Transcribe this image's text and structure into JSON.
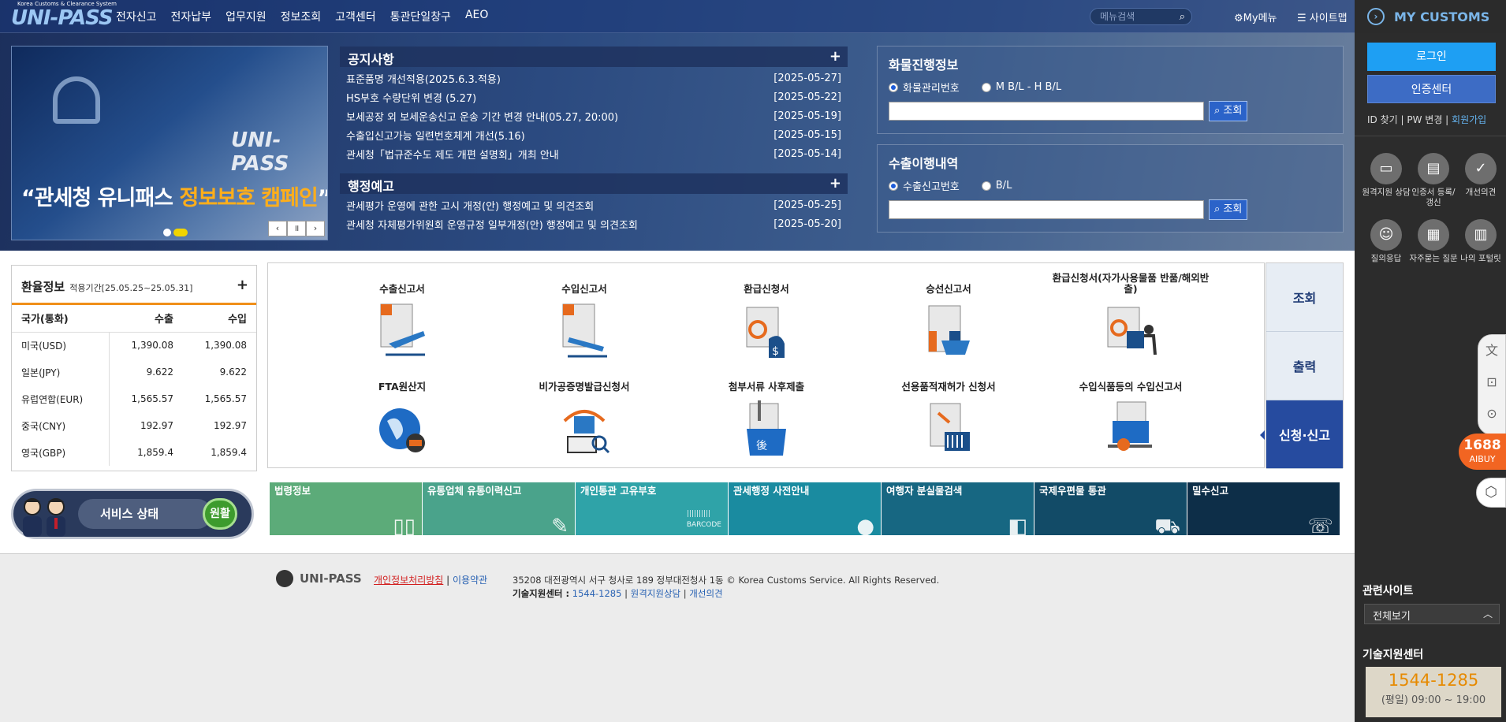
{
  "header": {
    "logo_sub": "Korea Customs & Clearance System",
    "logo": "UNI-PASS",
    "menu": [
      "전자신고",
      "전자납부",
      "업무지원",
      "정보조회",
      "고객센터",
      "통관단일창구",
      "AEO"
    ],
    "search_placeholder": "메뉴검색",
    "mymenu": "My메뉴",
    "sitemap": "사이트맵"
  },
  "banner": {
    "logo": "UNI-PASS",
    "caption_pre": "“관세청 유니패스 ",
    "caption_hl": "정보보호 캠페인",
    "caption_post": "”"
  },
  "notice": {
    "title": "공지사항",
    "items": [
      {
        "text": "표준품명 개선적용(2025.6.3.적용)",
        "date": "[2025-05-27]"
      },
      {
        "text": "HS부호 수량단위 변경 (5.27)",
        "date": "[2025-05-22]"
      },
      {
        "text": "보세공장 외 보세운송신고 운송 기간 변경 안내(05.27, 20:00)",
        "date": "[2025-05-19]"
      },
      {
        "text": "수출입신고가능 일련번호체계 개선(5.16)",
        "date": "[2025-05-15]"
      },
      {
        "text": "관세청「법규준수도 제도 개편 설명회」개최 안내",
        "date": "[2025-05-14]"
      }
    ]
  },
  "admin_notice": {
    "title": "행정예고",
    "items": [
      {
        "text": "관세평가 운영에 관한 고시 개정(안) 행정예고 및 의견조회",
        "date": "[2025-05-25]"
      },
      {
        "text": "관세청 자체평가위원회 운영규정 일부개정(안) 행정예고 및 의견조회",
        "date": "[2025-05-20]"
      }
    ]
  },
  "cargo": {
    "title": "화물진행정보",
    "radio1": "화물관리번호",
    "radio2": "M B/L - H B/L",
    "button": "조회"
  },
  "export_history": {
    "title": "수출이행내역",
    "radio1": "수출신고번호",
    "radio2": "B/L",
    "button": "조회"
  },
  "fx": {
    "title": "환율정보",
    "period": "적용기간[25.05.25~25.05.31]",
    "headers": [
      "국가(통화)",
      "수출",
      "수입"
    ],
    "rows": [
      {
        "c": "미국(USD)",
        "e": "1,390.08",
        "i": "1,390.08"
      },
      {
        "c": "일본(JPY)",
        "e": "9.622",
        "i": "9.622"
      },
      {
        "c": "유럽연합(EUR)",
        "e": "1,565.57",
        "i": "1,565.57"
      },
      {
        "c": "중국(CNY)",
        "e": "192.97",
        "i": "192.97"
      },
      {
        "c": "영국(GBP)",
        "e": "1,859.4",
        "i": "1,859.4"
      }
    ]
  },
  "service": {
    "label": "서비스 상태",
    "status": "원활"
  },
  "docs": [
    "수출신고서",
    "수입신고서",
    "환급신청서",
    "승선신고서",
    "환급신청서(자가사용물품 반품/해외반출)",
    "FTA원산지",
    "비가공증명발급신청서",
    "첨부서류 사후제출",
    "선용품적재허가 신청서",
    "수입식품등의 수입신고서"
  ],
  "tabs": [
    "조회",
    "출력",
    "신청·신고"
  ],
  "quick": [
    {
      "label": "법령정보",
      "color": "#5cab79",
      "icon": "📖"
    },
    {
      "label": "유통업체 유통이력신고",
      "color": "#4aa38b",
      "icon": "✎"
    },
    {
      "label": "개인통관 고유부호",
      "color": "#2fa3a8",
      "icon": "BARCODE"
    },
    {
      "label": "관세행정 사전안내",
      "color": "#1a8ba0",
      "icon": "👤"
    },
    {
      "label": "여행자 분실물검색",
      "color": "#176782",
      "icon": "📦"
    },
    {
      "label": "국제우편물 통관",
      "color": "#124b67",
      "icon": "🛒"
    },
    {
      "label": "밀수신고",
      "color": "#0d2e48",
      "icon": "☏"
    }
  ],
  "footer": {
    "logo": "UNI-PASS",
    "privacy": "개인정보처리방침",
    "terms": "이용약관",
    "address": "35208 대전광역시 서구 청사로 189 정부대전청사 1동 © Korea Customs Service. All Rights Reserved.",
    "tech_label": "기술지원센터 :",
    "tech_phone": "1544-1285",
    "remote": "원격지원상담",
    "suggest": "개선의견"
  },
  "side": {
    "title": "MY CUSTOMS",
    "login": "로그인",
    "cert": "인증센터",
    "id_find": "ID 찾기",
    "pw_change": "PW 변경",
    "join": "회원가입",
    "icons": [
      "원격지원 상담",
      "인증서 등록/갱신",
      "개선의견",
      "질의응답",
      "자주묻는 질문",
      "나의 포털릿"
    ],
    "related": "관련사이트",
    "related_select": "전체보기",
    "tech": "기술지원센터",
    "phone": "1544-1285",
    "hours": "(평일) 09:00 ~ 19:00"
  },
  "aibuy": {
    "num": "1688",
    "label": "AIBUY"
  }
}
